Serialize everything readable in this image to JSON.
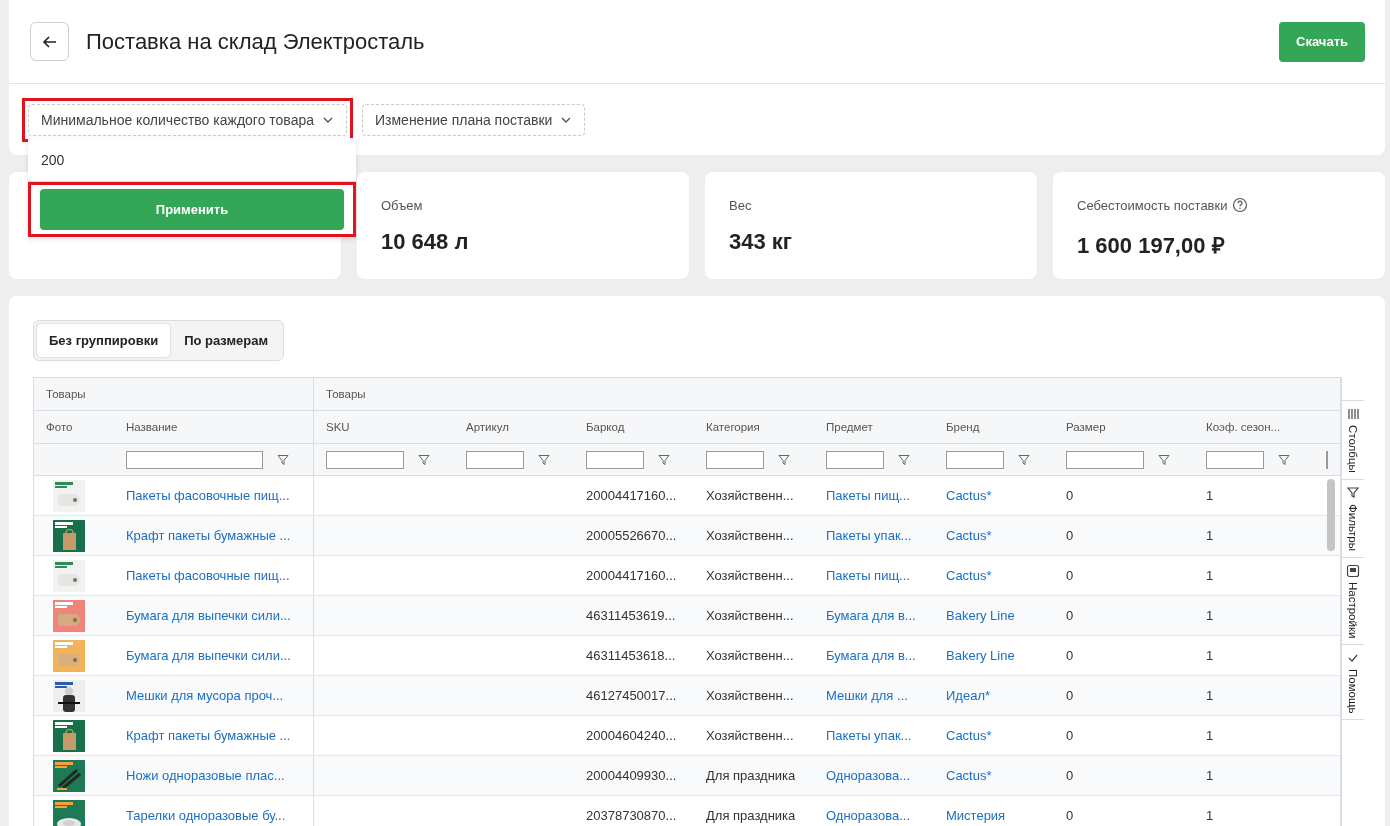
{
  "header": {
    "title": "Поставка на склад Электросталь",
    "download_button": "Скачать"
  },
  "filters": [
    {
      "label": "Минимальное количество каждого товара",
      "highlighted": true,
      "popup": {
        "value": "200",
        "apply_button": "Применить",
        "apply_highlighted": true
      }
    },
    {
      "label": "Изменение плана поставки",
      "highlighted": false
    }
  ],
  "stats": [
    {
      "kind": "covered"
    },
    {
      "kind": "stat",
      "label": "Объем",
      "value": "10 648 л"
    },
    {
      "kind": "stat",
      "label": "Вес",
      "value": "343 кг"
    },
    {
      "kind": "stat",
      "label": "Себестоимость поставки",
      "value": "1 600 197,00 ₽",
      "help": true
    }
  ],
  "grouping": [
    {
      "label": "Без группировки",
      "selected": true
    },
    {
      "label": "По размерам",
      "selected": false
    }
  ],
  "table": {
    "column_groups": [
      {
        "label": "Товары",
        "columns": [
          {
            "label": "Фото",
            "filter": false
          },
          {
            "label": "Название",
            "kind": "link",
            "filter": true
          }
        ]
      },
      {
        "label": "Товары",
        "columns": [
          {
            "label": "SKU",
            "kind": "text",
            "filter": true
          },
          {
            "label": "Артикул",
            "kind": "text",
            "filter": true
          },
          {
            "label": "Баркод",
            "kind": "text",
            "filter": true
          },
          {
            "label": "Категория",
            "kind": "text",
            "filter": true
          },
          {
            "label": "Предмет",
            "kind": "link",
            "filter": true
          },
          {
            "label": "Бренд",
            "kind": "link",
            "filter": true
          },
          {
            "label": "Размер",
            "kind": "text",
            "filter": true
          },
          {
            "label": "Коэф. сезон...",
            "kind": "text",
            "filter": true
          },
          {
            "kind": "text",
            "filter": true
          }
        ]
      }
    ],
    "rows": [
      {
        "cells": [
          {
            "kind": "picture"
          },
          "Пакеты фасовочные пищ...",
          null,
          null,
          "20004417160...",
          "Хозяйственн...",
          "Пакеты пищ...",
          "Cactus*",
          "0",
          "1",
          null
        ]
      },
      {
        "cells": [
          {
            "kind": "picture"
          },
          "Крафт пакеты бумажные ...",
          null,
          null,
          "20005526670...",
          "Хозяйственн...",
          "Пакеты упак...",
          "Cactus*",
          "0",
          "1",
          null
        ]
      },
      {
        "cells": [
          {
            "kind": "picture"
          },
          "Пакеты фасовочные пищ...",
          null,
          null,
          "20004417160...",
          "Хозяйственн...",
          "Пакеты пищ...",
          "Cactus*",
          "0",
          "1",
          null
        ]
      },
      {
        "cells": [
          {
            "kind": "picture"
          },
          "Бумага для выпечки сили...",
          null,
          null,
          "46311453619...",
          "Хозяйственн...",
          "Бумага для в...",
          "Bakery Line",
          "0",
          "1",
          null
        ]
      },
      {
        "cells": [
          {
            "kind": "picture"
          },
          "Бумага для выпечки сили...",
          null,
          null,
          "46311453618...",
          "Хозяйственн...",
          "Бумага для в...",
          "Bakery Line",
          "0",
          "1",
          null
        ]
      },
      {
        "cells": [
          {
            "kind": "picture"
          },
          "Мешки для мусора проч...",
          null,
          null,
          "46127450017...",
          "Хозяйственн...",
          "Мешки для ...",
          "Идеал*",
          "0",
          "1",
          null
        ]
      },
      {
        "cells": [
          {
            "kind": "picture"
          },
          "Крафт пакеты бумажные ...",
          null,
          null,
          "20004604240...",
          "Хозяйственн...",
          "Пакеты упак...",
          "Cactus*",
          "0",
          "1",
          null
        ]
      },
      {
        "cells": [
          {
            "kind": "picture"
          },
          "Ножи одноразовые плас...",
          null,
          null,
          "20004409930...",
          "Для праздника",
          "Одноразова...",
          "Cactus*",
          "0",
          "1",
          null
        ]
      },
      {
        "cells": [
          {
            "kind": "picture"
          },
          "Тарелки одноразовые бу...",
          null,
          null,
          "20378730870...",
          "Для праздника",
          "Одноразова...",
          "Мистерия",
          "0",
          "1",
          null
        ]
      }
    ]
  },
  "side_tabs": [
    {
      "label": "Столбцы",
      "kind": "columns"
    },
    {
      "label": "Фильтры",
      "kind": "filter"
    },
    {
      "label": "Настройки",
      "kind": "settings"
    },
    {
      "label": "Помощь",
      "kind": "check"
    }
  ]
}
